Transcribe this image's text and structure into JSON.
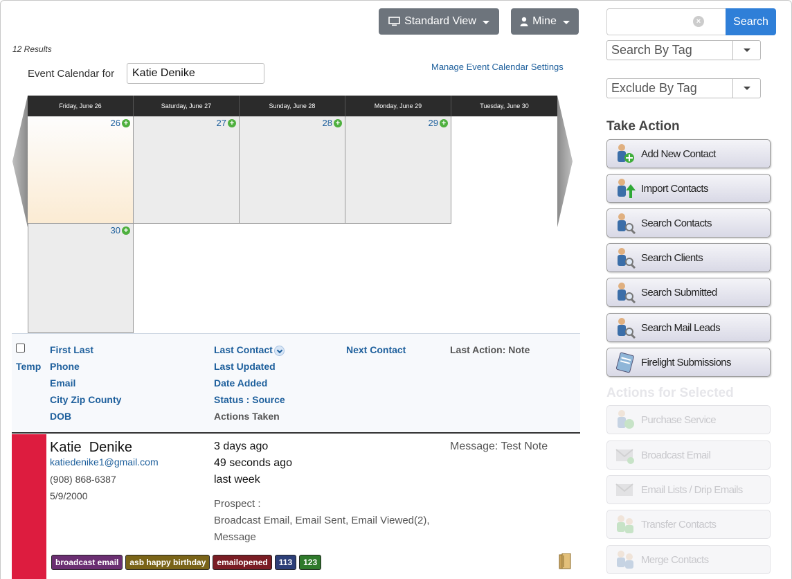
{
  "toolbar": {
    "standard_view_label": "Standard View",
    "mine_label": "Mine"
  },
  "results_count": "12 Results",
  "calendar": {
    "label": "Event Calendar for",
    "user_value": "Katie Denike",
    "manage_link": "Manage Event Calendar Settings",
    "days": [
      {
        "header": "Friday, June 26",
        "num": "26"
      },
      {
        "header": "Saturday, June 27",
        "num": "27"
      },
      {
        "header": "Sunday, June 28",
        "num": "28"
      },
      {
        "header": "Monday, June 29",
        "num": "29"
      },
      {
        "header": "Tuesday, June 30",
        "num": "30"
      }
    ]
  },
  "list_header": {
    "temp": "Temp",
    "first_last": "First Last",
    "phone": "Phone",
    "email": "Email",
    "city_zip_county": "City Zip County",
    "dob": "DOB",
    "last_contact": "Last Contact",
    "last_updated": "Last Updated",
    "date_added": "Date Added",
    "status_source": "Status : Source",
    "actions_taken": "Actions Taken",
    "next_contact": "Next Contact",
    "last_action": "Last Action: Note"
  },
  "record": {
    "first": "Katie",
    "last": "Denike",
    "email": "katiedenike1@gmail.com",
    "phone": "(908) 868-6387",
    "dob": "5/9/2000",
    "last_contact": "3 days ago",
    "last_updated": "49 seconds ago",
    "date_added": "last week",
    "status": "Prospect :",
    "actions_taken_1": "Broadcast Email, Email Sent, Email Viewed(2),",
    "actions_taken_2": "Message",
    "note": "Message: Test Note",
    "tags": [
      {
        "label": "broadcast email",
        "color": "#6b2f72"
      },
      {
        "label": "asb happy birthday",
        "color": "#7a6418"
      },
      {
        "label": "emailopened",
        "color": "#7a1d24"
      },
      {
        "label": "113",
        "color": "#2d3f78"
      },
      {
        "label": "123",
        "color": "#2f7a2b"
      }
    ]
  },
  "sidebar": {
    "search_placeholder": "",
    "search_button": "Search",
    "search_by_tag": "Search By Tag",
    "exclude_by_tag": "Exclude By Tag",
    "take_action_title": "Take Action",
    "actions": [
      "Add New Contact",
      "Import Contacts",
      "Search Contacts",
      "Search Clients",
      "Search Submitted",
      "Search Mail Leads",
      "Firelight Submissions"
    ],
    "selected_title": "Actions for Selected",
    "selected_actions": [
      "Purchase Service",
      "Broadcast Email",
      "Email Lists / Drip Emails",
      "Transfer Contacts",
      "Merge Contacts"
    ]
  }
}
